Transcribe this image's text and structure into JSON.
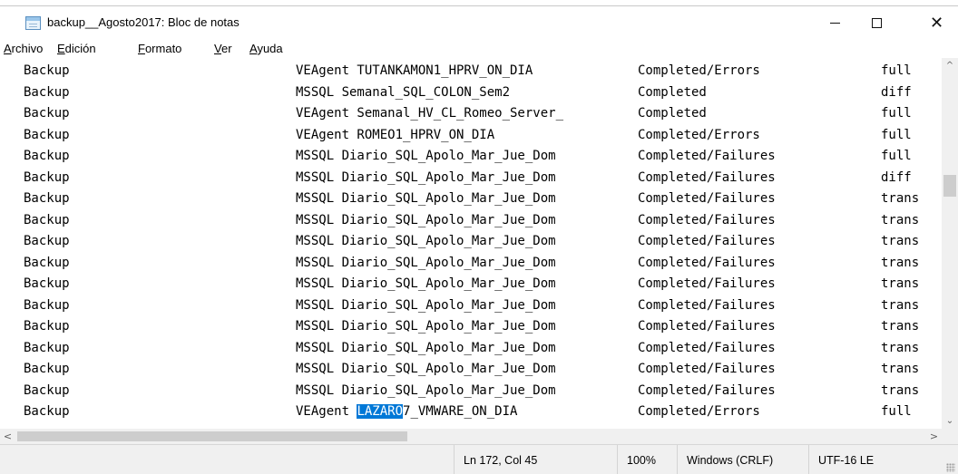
{
  "window": {
    "title": "backup__Agosto2017: Bloc de notas"
  },
  "controls": {
    "minimize": "—",
    "maximize": "☐",
    "close": "✕"
  },
  "menu": [
    {
      "access": "A",
      "rest": "rchivo"
    },
    {
      "access": "E",
      "rest": "dición"
    },
    {
      "access": "F",
      "rest": "ormato"
    },
    {
      "access": "V",
      "rest": "er"
    },
    {
      "access": "A",
      "rest": "yuda"
    }
  ],
  "rows": [
    {
      "type": "Backup",
      "policy": "VEAgent TUTANKAMON1_HPRV_ON_DIA",
      "status": "Completed/Errors",
      "level": "full"
    },
    {
      "type": "Backup",
      "policy": "MSSQL Semanal_SQL_COLON_Sem2",
      "status": "Completed",
      "level": "diff"
    },
    {
      "type": "Backup",
      "policy": "VEAgent Semanal_HV_CL_Romeo_Server_",
      "status": "Completed",
      "level": "full"
    },
    {
      "type": "Backup",
      "policy": "VEAgent ROMEO1_HPRV_ON_DIA",
      "status": "Completed/Errors",
      "level": "full"
    },
    {
      "type": "Backup",
      "policy": "MSSQL Diario_SQL_Apolo_Mar_Jue_Dom",
      "status": "Completed/Failures",
      "level": "full"
    },
    {
      "type": "Backup",
      "policy": "MSSQL Diario_SQL_Apolo_Mar_Jue_Dom",
      "status": "Completed/Failures",
      "level": "diff"
    },
    {
      "type": "Backup",
      "policy": "MSSQL Diario_SQL_Apolo_Mar_Jue_Dom",
      "status": "Completed/Failures",
      "level": "trans"
    },
    {
      "type": "Backup",
      "policy": "MSSQL Diario_SQL_Apolo_Mar_Jue_Dom",
      "status": "Completed/Failures",
      "level": "trans"
    },
    {
      "type": "Backup",
      "policy": "MSSQL Diario_SQL_Apolo_Mar_Jue_Dom",
      "status": "Completed/Failures",
      "level": "trans"
    },
    {
      "type": "Backup",
      "policy": "MSSQL Diario_SQL_Apolo_Mar_Jue_Dom",
      "status": "Completed/Failures",
      "level": "trans"
    },
    {
      "type": "Backup",
      "policy": "MSSQL Diario_SQL_Apolo_Mar_Jue_Dom",
      "status": "Completed/Failures",
      "level": "trans"
    },
    {
      "type": "Backup",
      "policy": "MSSQL Diario_SQL_Apolo_Mar_Jue_Dom",
      "status": "Completed/Failures",
      "level": "trans"
    },
    {
      "type": "Backup",
      "policy": "MSSQL Diario_SQL_Apolo_Mar_Jue_Dom",
      "status": "Completed/Failures",
      "level": "trans"
    },
    {
      "type": "Backup",
      "policy": "MSSQL Diario_SQL_Apolo_Mar_Jue_Dom",
      "status": "Completed/Failures",
      "level": "trans"
    },
    {
      "type": "Backup",
      "policy": "MSSQL Diario_SQL_Apolo_Mar_Jue_Dom",
      "status": "Completed/Failures",
      "level": "trans"
    },
    {
      "type": "Backup",
      "policy": "MSSQL Diario_SQL_Apolo_Mar_Jue_Dom",
      "status": "Completed/Failures",
      "level": "trans"
    },
    {
      "type": "Backup",
      "policy_before": "VEAgent ",
      "policy_selected": "LAZARO",
      "policy_after": "7_VMWARE_ON_DIA",
      "status": "Completed/Errors",
      "level": "full"
    }
  ],
  "status": {
    "position": "Ln 172, Col 45",
    "zoom": "100%",
    "line_endings": "Windows (CRLF)",
    "encoding": "UTF-16 LE"
  },
  "scroll": {
    "up": "^",
    "down": "⌄",
    "left": "<",
    "right": ">",
    "vertical_position": 0.32,
    "horizontal_fraction": 0.43
  },
  "colors": {
    "selection": "#0078d7",
    "background": "#ffffff",
    "chrome": "#f0f0f0"
  }
}
